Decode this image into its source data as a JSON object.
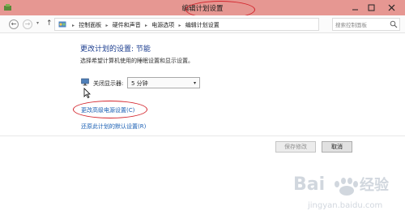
{
  "window": {
    "title": "编辑计划设置"
  },
  "address_bar": {
    "breadcrumbs": [
      "控制面板",
      "硬件和声音",
      "电源选项",
      "编辑计划设置"
    ],
    "search_placeholder": "搜索控制面板"
  },
  "main": {
    "heading": "更改计划的设置: 节能",
    "description": "选择希望计算机使用的睡眠设置和显示设置。",
    "turn_off_display": {
      "label": "关闭显示器:",
      "value": "5 分钟"
    },
    "links": {
      "advanced": "更改高级电源设置(C)",
      "restore": "还原此计划的默认设置(R)"
    }
  },
  "buttons": {
    "save": "保存修改",
    "cancel": "取消"
  },
  "colors": {
    "titlebar": "#e69792",
    "link": "#1a5fb4",
    "heading": "#1b3d8f",
    "annotation": "#d3232b"
  },
  "icons": [
    "app-icon",
    "minimize-icon",
    "maximize-icon",
    "close-icon",
    "back-icon",
    "forward-icon",
    "up-icon",
    "control-panel-icon",
    "refresh-icon",
    "search-icon",
    "monitor-icon",
    "cursor-icon"
  ]
}
